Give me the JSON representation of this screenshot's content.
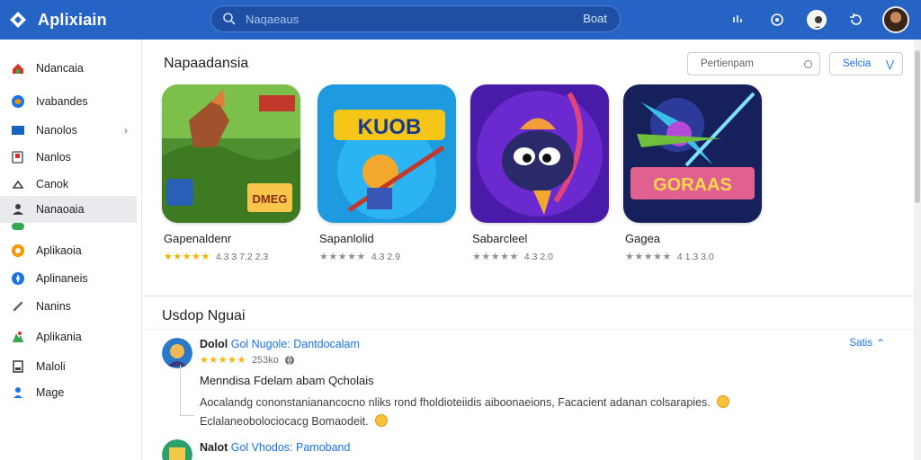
{
  "app": {
    "title": "Aplixiain"
  },
  "search": {
    "placeholder": "Naqaeaus",
    "button_label": "Boat"
  },
  "header_icons": [
    "download-icon",
    "settings-icon",
    "profile-icon",
    "history-icon",
    "user-avatar"
  ],
  "sidebar": {
    "items": [
      {
        "label": "Ndancaia",
        "icon": "home-icon",
        "color": "#d93025"
      },
      {
        "label": "Ivabandes",
        "icon": "globe-icon",
        "color": "#1a73e8"
      },
      {
        "label": "Nanolos",
        "icon": "apps-icon",
        "color": "#1565c0",
        "has_chevron": true
      },
      {
        "label": "Nanlos",
        "icon": "tag-icon",
        "color": "#5f6368"
      },
      {
        "label": "Canok",
        "icon": "cloud-icon",
        "color": "#5f6368"
      },
      {
        "label": "Nanaoaia",
        "icon": "user-icon",
        "color": "#3c4043",
        "active": true
      },
      {
        "label": "",
        "icon": "gamepad-icon",
        "color": "#34a853"
      },
      {
        "label": "Aplikaoia",
        "icon": "circle-icon",
        "color": "#f29900"
      },
      {
        "label": "Aplinaneis",
        "icon": "compass-icon",
        "color": "#1a73e8"
      },
      {
        "label": "Nanins",
        "icon": "link-icon",
        "color": "#5f6368"
      },
      {
        "label": "Aplikania",
        "icon": "puzzle-icon",
        "color": "#34a853"
      },
      {
        "label": "Maloli",
        "icon": "book-icon",
        "color": "#3c4043"
      },
      {
        "label": "Mage",
        "icon": "person-icon",
        "color": "#1a73e8"
      }
    ]
  },
  "featured": {
    "title": "Napaadansia",
    "sort_placeholder": "Pertienpam",
    "filter_label": "Selcia",
    "apps": [
      {
        "name": "Gapenaldenr",
        "stars": "★★★★★",
        "star_color": "gold",
        "rating_text": "4.3 3 7.2 2.3",
        "thumb_text": "DMEG"
      },
      {
        "name": "Sapanlolid",
        "stars": "★★★★★",
        "star_color": "gray",
        "rating_text": "4.3 2.9",
        "thumb_text": "KUOB"
      },
      {
        "name": "Sabarcleel",
        "stars": "★★★★★",
        "star_color": "gray",
        "rating_text": "4.3 2.0",
        "thumb_text": ""
      },
      {
        "name": "Gagea",
        "stars": "★★★★★",
        "star_color": "gray",
        "rating_text": "4 1.3 3.0",
        "thumb_text": "GORAAS"
      }
    ]
  },
  "reviews": {
    "title": "Usdop Nguai",
    "items": [
      {
        "author": "Dolol",
        "app_ref": "Gol Nugole: Dantdocalam",
        "stars": "★★★★★",
        "meta": "253ko",
        "reply_label": "Satis",
        "title": "Menndisa Fdelam abam Qcholais",
        "body": "Aocalandg cononstanianancocno nliks rond fholdioteiidis aiboonaeions, Facacient adanan colsarapies.",
        "body_cont": "Eclalaneobolociocacg Bomaodeit."
      },
      {
        "author": "Nalot",
        "app_ref": "Gol Vhodos: Pamoband",
        "stars": "",
        "meta": "",
        "reply_label": "",
        "title": "",
        "body": "",
        "body_cont": ""
      }
    ]
  }
}
